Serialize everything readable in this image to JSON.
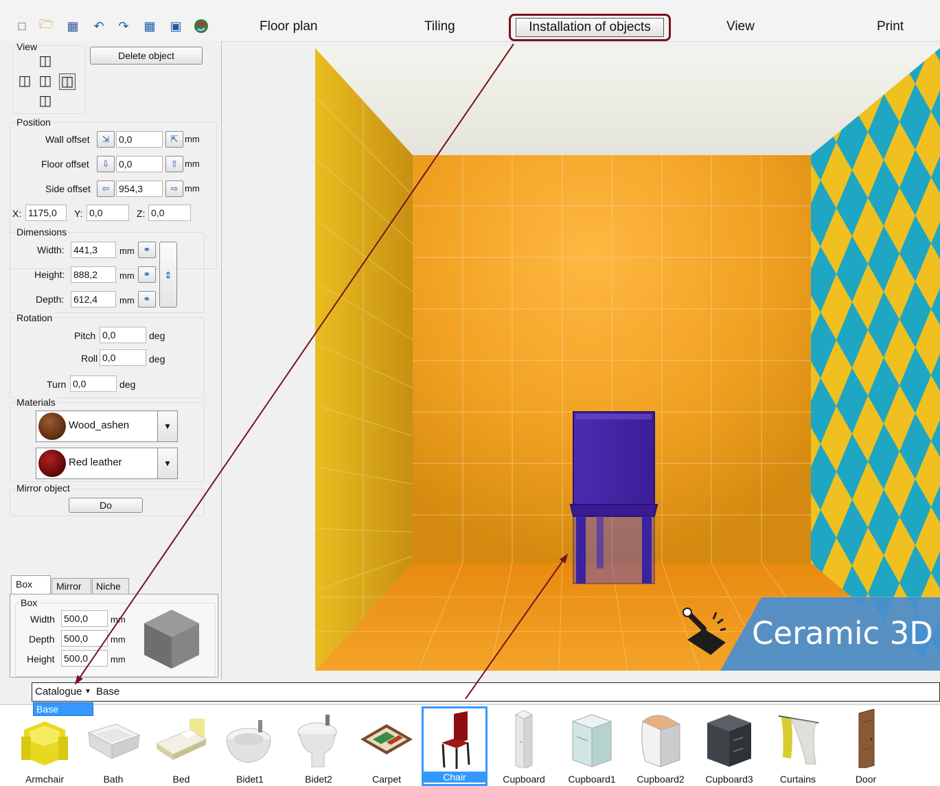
{
  "menu": {
    "floor_plan": "Floor plan",
    "tiling": "Tiling",
    "installation": "Installation of objects",
    "view": "View",
    "print": "Print"
  },
  "toolbar_icons": [
    "new-file-icon",
    "open-folder-icon",
    "save-icon",
    "undo-icon",
    "redo-icon",
    "calculator-icon",
    "render-icon",
    "globe-icon"
  ],
  "left_panel": {
    "view_label": "View",
    "delete_object": "Delete object",
    "position": {
      "label": "Position",
      "wall_offset_label": "Wall offset",
      "wall_offset": "0,0",
      "floor_offset_label": "Floor offset",
      "floor_offset": "0,0",
      "side_offset_label": "Side offset",
      "side_offset": "954,3",
      "unit": "mm",
      "x_label": "X:",
      "x": "1175,0",
      "y_label": "Y:",
      "y": "0,0",
      "z_label": "Z:",
      "z": "0,0"
    },
    "dimensions": {
      "label": "Dimensions",
      "width_label": "Width:",
      "width": "441,3",
      "height_label": "Height:",
      "height": "888,2",
      "depth_label": "Depth:",
      "depth": "612,4",
      "unit": "mm"
    },
    "rotation": {
      "label": "Rotation",
      "pitch_label": "Pitch",
      "pitch": "0,0",
      "roll_label": "Roll",
      "roll": "0,0",
      "turn_label": "Turn",
      "turn": "0,0",
      "unit": "deg"
    },
    "materials": {
      "label": "Materials",
      "material1": "Wood_ashen",
      "material2": "Red leather"
    },
    "mirror": {
      "label": "Mirror object",
      "button": "Do"
    },
    "tabs": [
      "Box",
      "Mirror",
      "Niche"
    ],
    "box": {
      "label": "Box",
      "width_label": "Width",
      "width": "500,0",
      "depth_label": "Depth",
      "depth": "500,0",
      "height_label": "Height",
      "height": "500,0",
      "unit": "mm"
    }
  },
  "viewport": {
    "logo_text": "Ceramic 3D"
  },
  "catalogue": {
    "label": "Catalogue",
    "current": "Base",
    "dropdown_option": "Base",
    "items": [
      "Armchair",
      "Bath",
      "Bed",
      "Bidet1",
      "Bidet2",
      "Carpet",
      "Chair",
      "Cupboard",
      "Cupboard1",
      "Cupboard2",
      "Cupboard3",
      "Curtains",
      "Door"
    ],
    "selected": "Chair"
  },
  "colors": {
    "accent_highlight": "#7a1020",
    "selection": "#3399ff",
    "wall_orange": "#f0a020",
    "wall_yellow": "#e8c020",
    "wall_teal": "#1aa8c0"
  }
}
